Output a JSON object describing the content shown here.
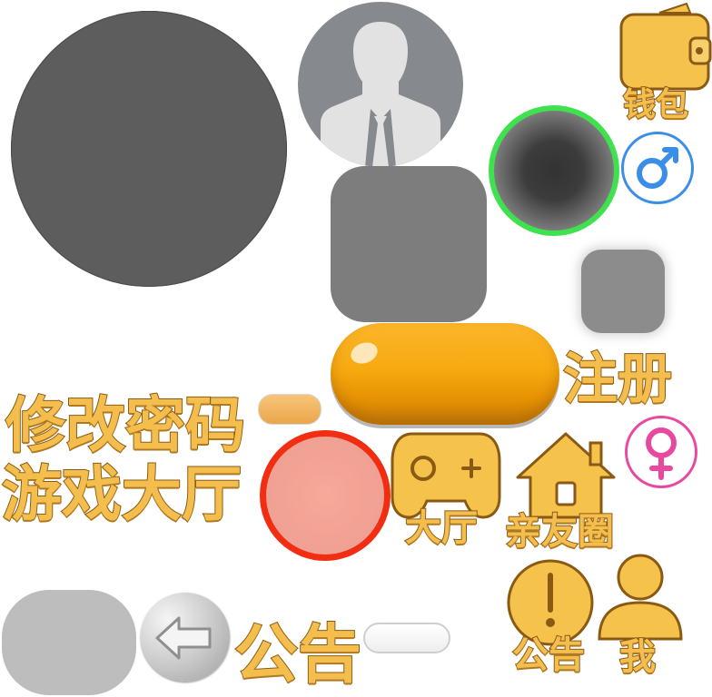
{
  "labels": {
    "wallet": "钱包",
    "register": "注册",
    "change_password": "修改密码",
    "game_lobby": "游戏大厅",
    "lobby": "大厅",
    "friends_circle": "亲友圈",
    "notice_large": "公告",
    "notice_small": "公告",
    "me": "我"
  },
  "colors": {
    "gold": "#f4be4f",
    "gold_outline": "#8a5a14",
    "green_ring": "#3fe14f",
    "red_ring": "#f22e12",
    "male_blue": "#3a8ee8",
    "female_pink": "#e8489e"
  },
  "icons": [
    "wallet-icon",
    "male-icon",
    "female-icon",
    "gamepad-icon",
    "house-icon",
    "alert-icon",
    "user-icon",
    "back-arrow-icon",
    "avatar-silhouette-icon"
  ]
}
